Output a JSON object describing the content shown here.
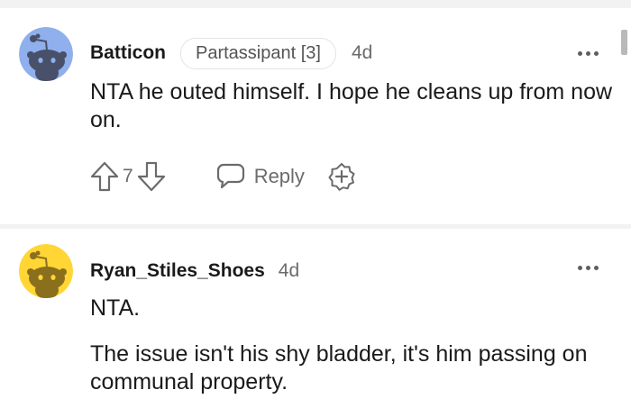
{
  "comments": [
    {
      "username": "Batticon",
      "flair": "Partassipant [3]",
      "time": "4d",
      "body": [
        "NTA he outed himself. I hope he cleans up from now on."
      ],
      "votes": "7",
      "reply_label": "Reply",
      "avatar_color": "#8fb0ec"
    },
    {
      "username": "Ryan_Stiles_Shoes",
      "time": "4d",
      "body": [
        "NTA.",
        "The issue isn't his shy bladder, it's him passing on communal property."
      ],
      "avatar_color": "#ffd635"
    }
  ],
  "icons": {
    "avatar": "reddit-snoo-icon",
    "more": "more-options-icon",
    "upvote": "upvote-arrow-icon",
    "downvote": "downvote-arrow-icon",
    "reply": "speech-bubble-icon",
    "award": "award-plus-icon"
  },
  "colors": {
    "text": "#1a1a1b",
    "muted": "#6b6b6b",
    "divider": "#f2f2f2"
  }
}
